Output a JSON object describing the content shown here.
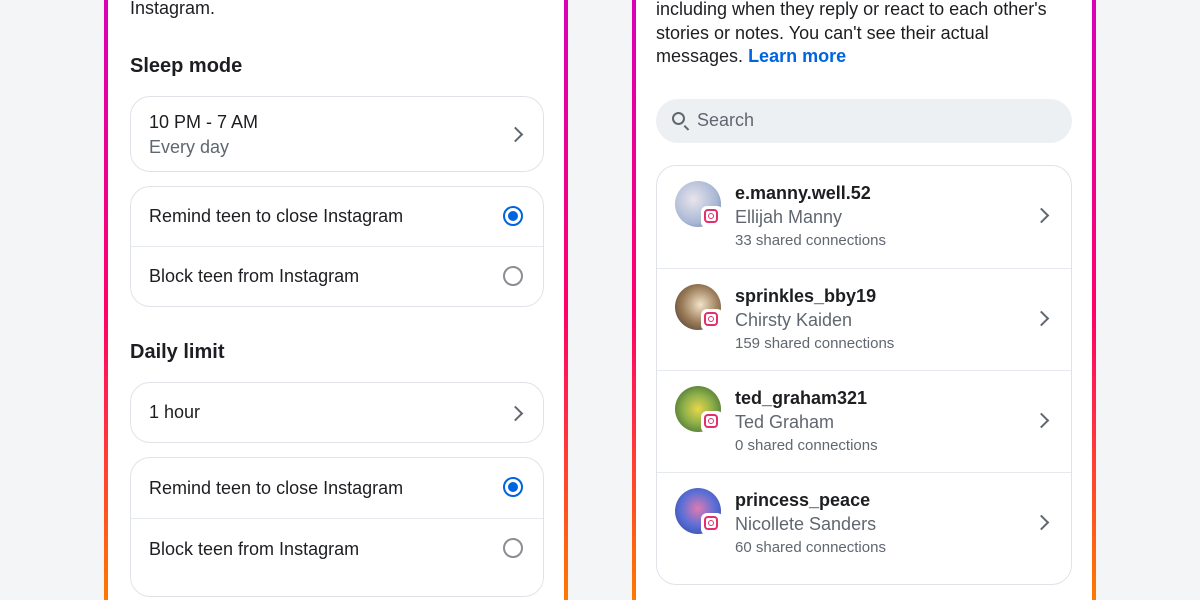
{
  "left_panel": {
    "top_text": "Instagram.",
    "sleep_mode": {
      "title": "Sleep mode",
      "time_range": "10 PM - 7 AM",
      "frequency": "Every day",
      "options": [
        {
          "label": "Remind teen to close Instagram",
          "selected": true
        },
        {
          "label": "Block teen from Instagram",
          "selected": false
        }
      ]
    },
    "daily_limit": {
      "title": "Daily limit",
      "value": "1 hour",
      "options": [
        {
          "label": "Remind teen to close Instagram",
          "selected": true
        },
        {
          "label": "Block teen from Instagram",
          "selected": false
        }
      ]
    }
  },
  "right_panel": {
    "description_lines": [
      "including when they reply or react to each other's",
      "stories or notes. You can't see their actual",
      "messages."
    ],
    "learn_more": "Learn more",
    "search": {
      "placeholder": "Search"
    },
    "people": [
      {
        "username": "e.manny.well.52",
        "name": "Ellijah Manny",
        "connections": "33 shared connections",
        "avatar_color": "#b9c6dc"
      },
      {
        "username": "sprinkles_bby19",
        "name": "Chirsty Kaiden",
        "connections": "159 shared connections",
        "avatar_color": "#7a6752"
      },
      {
        "username": "ted_graham321",
        "name": "Ted Graham",
        "connections": "0 shared connections",
        "avatar_color": "#6a9a3a"
      },
      {
        "username": "princess_peace",
        "name": "Nicollete Sanders",
        "connections": "60 shared connections",
        "avatar_color": "#3a63c9"
      }
    ]
  },
  "colors": {
    "accent": "#0064e0",
    "border_gradient_top": "#d300c5",
    "border_gradient_bottom": "#ff7a00"
  }
}
